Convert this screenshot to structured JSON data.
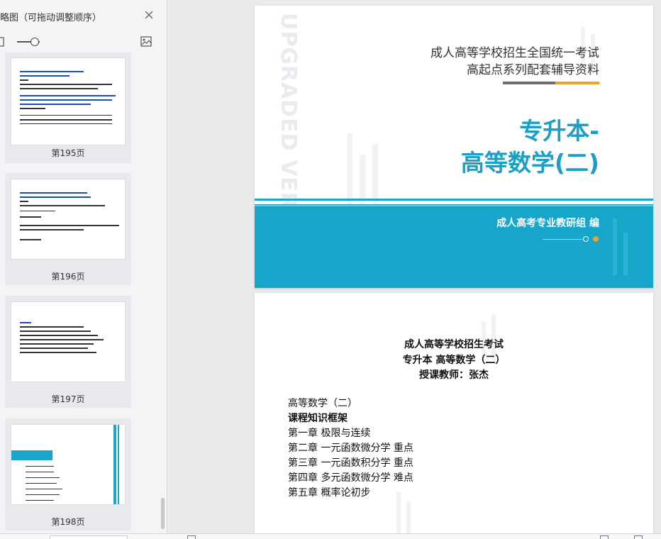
{
  "thumbnail_panel": {
    "title": "略图（可拖动调整顺序）",
    "close_icon": "close-icon",
    "zoom_icons": [
      "shrink-icon",
      "image-icon"
    ],
    "zoom_level": 0.55
  },
  "thumbnails": [
    {
      "label": "第195页"
    },
    {
      "label": "第196页"
    },
    {
      "label": "第197页"
    },
    {
      "label": "第198页"
    }
  ],
  "cover": {
    "line1": "成人高等学校招生全国统一考试",
    "line2": "高起点系列配套辅导资料",
    "title_line1": "专升本-",
    "title_line2": "高等数学(二)",
    "editor": "成人高考专业教研组 编",
    "watermark": "UPGRADED VERSION",
    "accent_color": "#17a6c9",
    "orange_color": "#f0a12c"
  },
  "content_page": {
    "heading1": "成人高等学校招生考试",
    "heading2": "专升本  高等数学（二）",
    "heading3": "授课教师：张杰",
    "lines": [
      "高等数学（二）",
      "课程知识框架",
      "第一章  极限与连续",
      "第二章  一元函数微分学  重点",
      "第三章  一元函数积分学  重点",
      "第四章  多元函数微分学  难点",
      "第五章  概率论初步"
    ]
  }
}
